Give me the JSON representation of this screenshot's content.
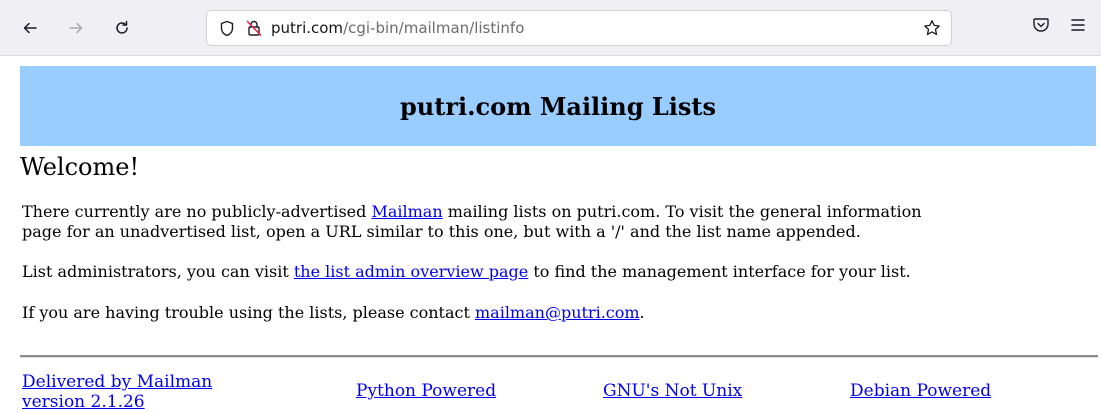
{
  "browser": {
    "url_host": "putri.com",
    "url_path": "/cgi-bin/mailman/listinfo"
  },
  "page": {
    "banner_title": "putri.com Mailing Lists",
    "welcome": "Welcome!",
    "para1": {
      "before": "There currently are no publicly-advertised ",
      "link": "Mailman",
      "after_line1": " mailing lists on putri.com. To visit the general information",
      "line2": "page for an unadvertised list, open a URL similar to this one, but with a '/' and the list name appended."
    },
    "para2": {
      "before": "List administrators, you can visit ",
      "link": "the list admin overview page",
      "after": " to find the management interface for your list."
    },
    "para3": {
      "before": "If you are having trouble using the lists, please contact ",
      "link": "mailman@putri.com",
      "after": "."
    }
  },
  "footer": {
    "mailman_line1": "Delivered by Mailman",
    "mailman_line2": "version 2.1.26",
    "python": "Python Powered",
    "gnu": "GNU's Not Unix",
    "debian": "Debian Powered"
  },
  "icons": {
    "back": "back-arrow-icon",
    "forward": "forward-arrow-icon",
    "reload": "reload-icon",
    "shield": "tracking-protection-shield-icon",
    "lock": "insecure-lock-icon",
    "star": "bookmark-star-icon",
    "pocket": "pocket-icon",
    "menu": "hamburger-menu-icon"
  }
}
